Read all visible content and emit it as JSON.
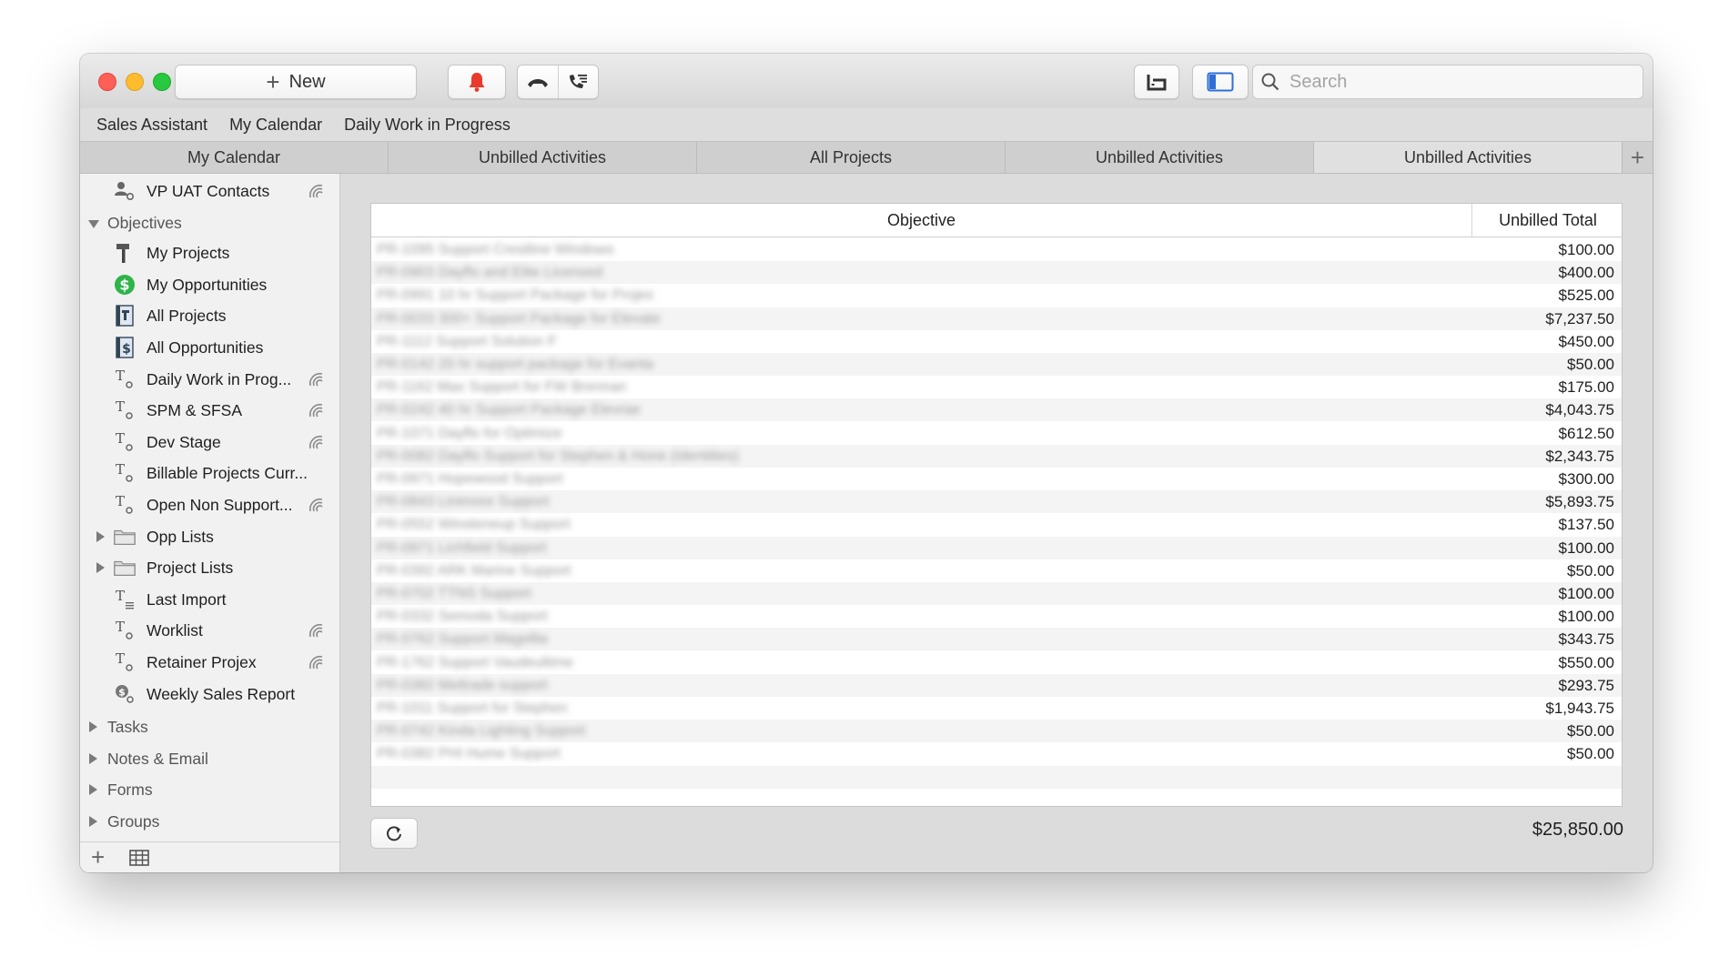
{
  "toolbar": {
    "new_label": "New",
    "search_placeholder": "Search"
  },
  "favorites": [
    "Sales Assistant",
    "My Calendar",
    "Daily Work in Progress"
  ],
  "tabs": [
    {
      "label": "My Calendar",
      "active": false
    },
    {
      "label": "Unbilled Activities",
      "active": false
    },
    {
      "label": "All Projects",
      "active": false
    },
    {
      "label": "Unbilled Activities",
      "active": false
    },
    {
      "label": "Unbilled Activities",
      "active": true
    }
  ],
  "sidebar": {
    "top_item": {
      "label": "VP UAT Contacts",
      "icon": "person-gear-icon",
      "synced": true
    },
    "objectives_label": "Objectives",
    "items": [
      {
        "label": "My Projects",
        "icon": "hammer-icon",
        "synced": false
      },
      {
        "label": "My Opportunities",
        "icon": "dollar-circle-icon",
        "synced": false
      },
      {
        "label": "All Projects",
        "icon": "project-book-icon",
        "synced": false
      },
      {
        "label": "All Opportunities",
        "icon": "opportunity-book-icon",
        "synced": false
      },
      {
        "label": "Daily Work in Prog...",
        "icon": "text-gear-icon",
        "synced": true
      },
      {
        "label": "SPM & SFSA",
        "icon": "text-gear-icon",
        "synced": true
      },
      {
        "label": "Dev Stage",
        "icon": "text-gear-icon",
        "synced": true
      },
      {
        "label": "Billable Projects Curr...",
        "icon": "text-gear-icon",
        "synced": false
      },
      {
        "label": "Open Non Support...",
        "icon": "text-gear-icon",
        "synced": true
      },
      {
        "label": "Opp Lists",
        "icon": "folder-icon",
        "synced": false,
        "folder": true
      },
      {
        "label": "Project Lists",
        "icon": "folder-icon",
        "synced": false,
        "folder": true
      },
      {
        "label": "Last Import",
        "icon": "text-list-icon",
        "synced": false
      },
      {
        "label": "Worklist",
        "icon": "text-gear-icon",
        "synced": true
      },
      {
        "label": "Retainer Projex",
        "icon": "text-gear-icon",
        "synced": true
      },
      {
        "label": "Weekly Sales Report",
        "icon": "dollar-gear-icon",
        "synced": false
      }
    ],
    "sections": [
      "Tasks",
      "Notes & Email",
      "Forms",
      "Groups"
    ]
  },
  "table": {
    "col_objective": "Objective",
    "col_total": "Unbilled Total",
    "rows": [
      {
        "objective": "PR-1095 Support Crestline Windows",
        "total": "$100.00"
      },
      {
        "objective": "PR-0903 Dayflo and Elite Licensed",
        "total": "$400.00"
      },
      {
        "objective": "PR-0991 10 hr Support Package for Projex",
        "total": "$525.00"
      },
      {
        "objective": "PR-0033 300+ Support Package for Elevate",
        "total": "$7,237.50"
      },
      {
        "objective": "PR-1112 Support Solution F",
        "total": "$450.00"
      },
      {
        "objective": "PR-0142 20 hr support package for Evanta",
        "total": "$50.00"
      },
      {
        "objective": "PR-1162 Max Support for FW Brennan",
        "total": "$175.00"
      },
      {
        "objective": "PR-0242 40 hr Support Package Elevrae",
        "total": "$4,043.75"
      },
      {
        "objective": "PR-1071 Dayflo for Optimize",
        "total": "$612.50"
      },
      {
        "objective": "PR-0082 Dayflo Support for Stephen & Hone (Identities)",
        "total": "$2,343.75"
      },
      {
        "objective": "PR-0971 Hopewood Support",
        "total": "$300.00"
      },
      {
        "objective": "PR-0843 Linimore Support",
        "total": "$5,893.75"
      },
      {
        "objective": "PR-0552 Winsteneup Support",
        "total": "$137.50"
      },
      {
        "objective": "PR-0971 Lichfield Support",
        "total": "$100.00"
      },
      {
        "objective": "PR-0392 ARK Marine Support",
        "total": "$50.00"
      },
      {
        "objective": "PR-0702 TTNS Support",
        "total": "$100.00"
      },
      {
        "objective": "PR-0332 Semoda Support",
        "total": "$100.00"
      },
      {
        "objective": "PR-0762 Support Magellia",
        "total": "$343.75"
      },
      {
        "objective": "PR-1762 Support Vaudeultime",
        "total": "$550.00"
      },
      {
        "objective": "PR-0382 Meltrade support",
        "total": "$293.75"
      },
      {
        "objective": "PR-1011 Support for Stephen",
        "total": "$1,943.75"
      },
      {
        "objective": "PR-0742 Kinda Lighting Support",
        "total": "$50.00"
      },
      {
        "objective": "PR-0382 PHI Hume Support",
        "total": "$50.00"
      }
    ],
    "grand_total": "$25,850.00"
  }
}
